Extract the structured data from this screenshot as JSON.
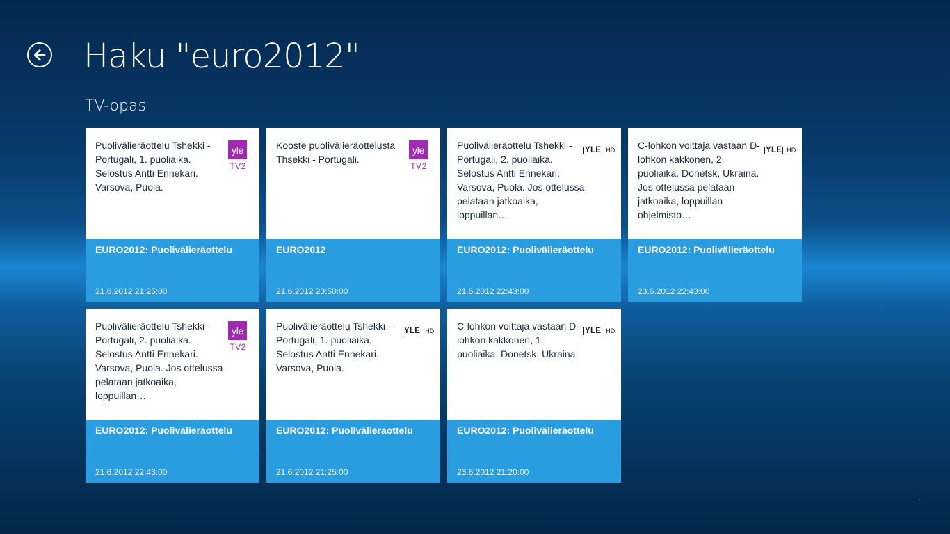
{
  "header": {
    "back_label": "back",
    "title": "Haku \"euro2012\""
  },
  "section": {
    "title": "TV-opas"
  },
  "logos": {
    "yle": "yle",
    "tv2": "TV2",
    "yle_hd_name": "YLE",
    "yle_hd_suffix": "HD"
  },
  "colors": {
    "tile_accent": "#2a9de0",
    "tile_body": "#ffffff",
    "yle_tv2_purple": "#9e2ab0"
  },
  "results": [
    {
      "description": "Puolivälieräottelu Tshekki - Portugali, 1. puoliaika. Selostus Antti Ennekari. Varsova, Puola.",
      "title": "EURO2012: Puolivälieräottelu",
      "time": "21.6.2012 21:25:00",
      "channel": "yle-tv2"
    },
    {
      "description": "Kooste puolivälieräottelusta Thsekki - Portugali.",
      "title": "EURO2012",
      "time": "21.6.2012 23:50:00",
      "channel": "yle-tv2"
    },
    {
      "description": "Puolivälieräottelu Tshekki - Portugali, 2. puoliaika. Selostus Antti Ennekari. Varsova, Puola. Jos ottelussa pelataan jatkoaika, loppuillan…",
      "title": "EURO2012: Puolivälieräottelu",
      "time": "21.6.2012 22:43:00",
      "channel": "yle-hd"
    },
    {
      "description": "C-lohkon voittaja vastaan D-lohkon kakkonen, 2. puoliaika. Donetsk, Ukraina. Jos ottelussa pelataan jatkoaika, loppuillan ohjelmisto…",
      "title": "EURO2012: Puolivälieräottelu",
      "time": "23.6.2012 22:43:00",
      "channel": "yle-hd"
    },
    {
      "description": "Puolivälieräottelu Tshekki - Portugali, 2. puoliaika. Selostus Antti Ennekari. Varsova, Puola. Jos ottelussa pelataan jatkoaika, loppuillan…",
      "title": "EURO2012: Puolivälieräottelu",
      "time": "21.6.2012 22:43:00",
      "channel": "yle-tv2"
    },
    {
      "description": "Puolivälieräottelu Tshekki - Portugali, 1. puoliaika. Selostus Antti Ennekari. Varsova, Puola.",
      "title": "EURO2012: Puolivälieräottelu",
      "time": "21.6.2012 21:25:00",
      "channel": "yle-hd"
    },
    {
      "description": "C-lohkon voittaja vastaan D-lohkon kakkonen, 1. puoliaika. Donetsk, Ukraina.",
      "title": "EURO2012: Puolivälieräottelu",
      "time": "23.6.2012 21:20:00",
      "channel": "yle-hd"
    }
  ]
}
